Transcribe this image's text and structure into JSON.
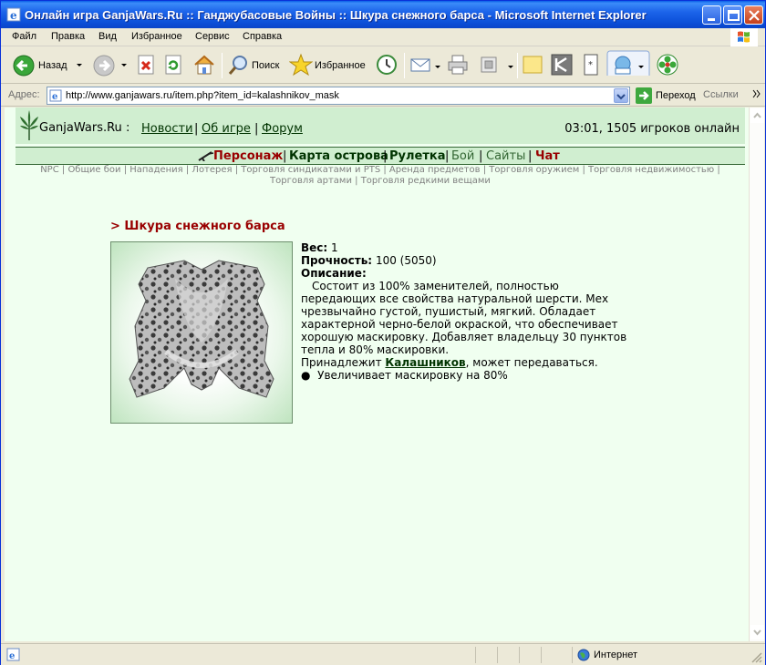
{
  "window": {
    "title": "Онлайн игра GanjaWars.Ru :: Ганджубасовые Войны :: Шкура снежного барса - Microsoft Internet Explorer"
  },
  "menu": [
    "Файл",
    "Правка",
    "Вид",
    "Избранное",
    "Сервис",
    "Справка"
  ],
  "toolbar": {
    "back_label": "Назад",
    "search_label": "Поиск",
    "favorites_label": "Избранное"
  },
  "address": {
    "label": "Адрес:",
    "url": "http://www.ganjawars.ru/item.php?item_id=kalashnikov_mask",
    "go_label": "Переход",
    "links_label": "Ссылки"
  },
  "site": {
    "name": "GanjaWars.Ru",
    "name_sep": ":",
    "header_links": [
      "Новости",
      "Об игре",
      "Форум"
    ],
    "online_status": "03:01, 1505 игроков онлайн"
  },
  "nav_main": [
    {
      "label": "Персонаж",
      "color": "#990000"
    },
    {
      "label": "Карта острова",
      "color": "#003300"
    },
    {
      "label": "Рулетка",
      "color": "#003300"
    },
    {
      "label": "Бой",
      "color": "#336633"
    },
    {
      "label": "Сайты",
      "color": "#336633"
    },
    {
      "label": "Чат",
      "color": "#990000"
    }
  ],
  "nav_sub": [
    "NPC",
    "Общие бои",
    "Нападения",
    "Лотерея",
    "Торговля синдикатами и PTS",
    "Аренда предметов",
    "Торговля оружием",
    "Торговля недвижимостью",
    "Торговля артами",
    "Торговля редкими вещами"
  ],
  "item": {
    "title": "> Шкура снежного барса",
    "weight_label": "Вес:",
    "weight_value": "1",
    "durability_label": "Прочность:",
    "durability_value": "100 (5050)",
    "description_label": "Описание:",
    "description_lines": [
      "Состоит из 100% заменителей, полностью",
      "передающих все свойства натуральной шерсти. Мех",
      "чрезвычайно густой, пушистый, мягкий. Обладает",
      "характерной черно-белой окраской, что обеспечивает",
      "хорошую маскировку. Добавляет владельцу 30 пунктов",
      "тепла и 80% маскировки."
    ],
    "owner_prefix": "Принадлежит",
    "owner_name": "Калашников",
    "owner_suffix": ", может передаваться.",
    "bonus": "Увеличивает маскировку на 80%"
  },
  "status": {
    "zone": "Интернет"
  }
}
